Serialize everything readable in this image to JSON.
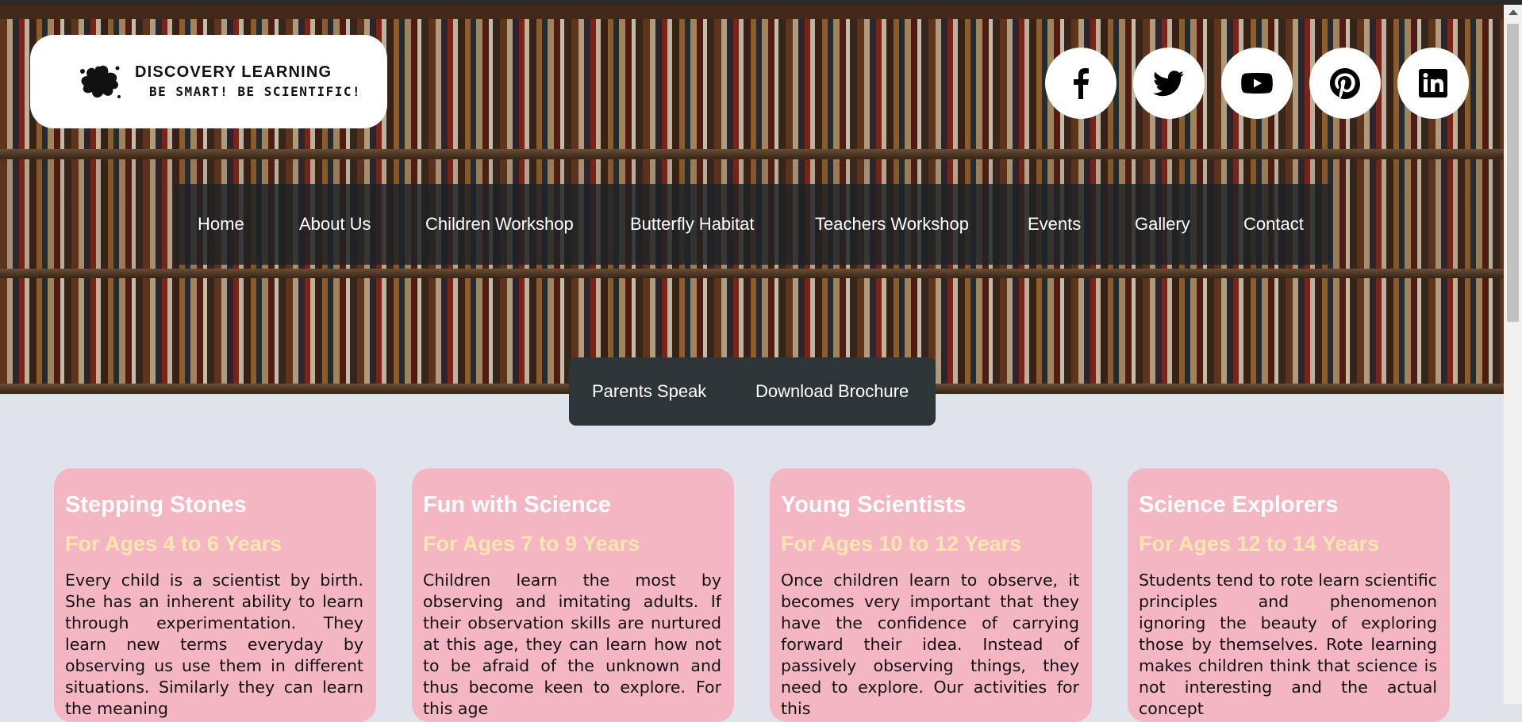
{
  "logo": {
    "title": "DISCOVERY LEARNING",
    "tagline": "BE SMART! BE SCIENTIFIC!"
  },
  "social": [
    {
      "name": "facebook-icon"
    },
    {
      "name": "twitter-icon"
    },
    {
      "name": "youtube-icon"
    },
    {
      "name": "pinterest-icon"
    },
    {
      "name": "linkedin-icon"
    }
  ],
  "nav": {
    "items": [
      "Home",
      "About Us",
      "Children Workshop",
      "Butterfly Habitat",
      "Teachers Workshop",
      "Events",
      "Gallery",
      "Contact"
    ]
  },
  "subnav": {
    "items": [
      "Parents Speak",
      "Download Brochure"
    ]
  },
  "cards": [
    {
      "title": "Stepping Stones",
      "age": "For Ages 4 to 6 Years",
      "body": "Every child is a scientist by birth. She has an inherent ability to learn through experimentation. They learn new terms everyday by observing us use them in different situations. Similarly they can learn the meaning"
    },
    {
      "title": "Fun with Science",
      "age": "For Ages 7 to 9 Years",
      "body": "Children learn the most by observing and imitating adults. If their observation skills are nurtured at this age, they can learn how not to be afraid of the unknown and thus become keen to explore. For this age"
    },
    {
      "title": "Young Scientists",
      "age": "For Ages 10 to 12 Years",
      "body": "Once children learn to observe, it becomes very important that they have the confidence of carrying forward their idea. Instead of passively observing things, they need to explore. Our activities for this"
    },
    {
      "title": "Science Explorers",
      "age": "For Ages 12 to 14 Years",
      "body": "Students tend to rote learn scientific principles and phenomenon ignoring the beauty of exploring those by themselves. Rote learning makes children think that science is not interesting and the actual concept"
    }
  ],
  "colors": {
    "page_bg": "#dfe4ec",
    "card_bg": "#f4b6c2",
    "card_title": "#ffffff",
    "card_age": "#fbe6b0",
    "nav_bg": "#1e2226"
  }
}
